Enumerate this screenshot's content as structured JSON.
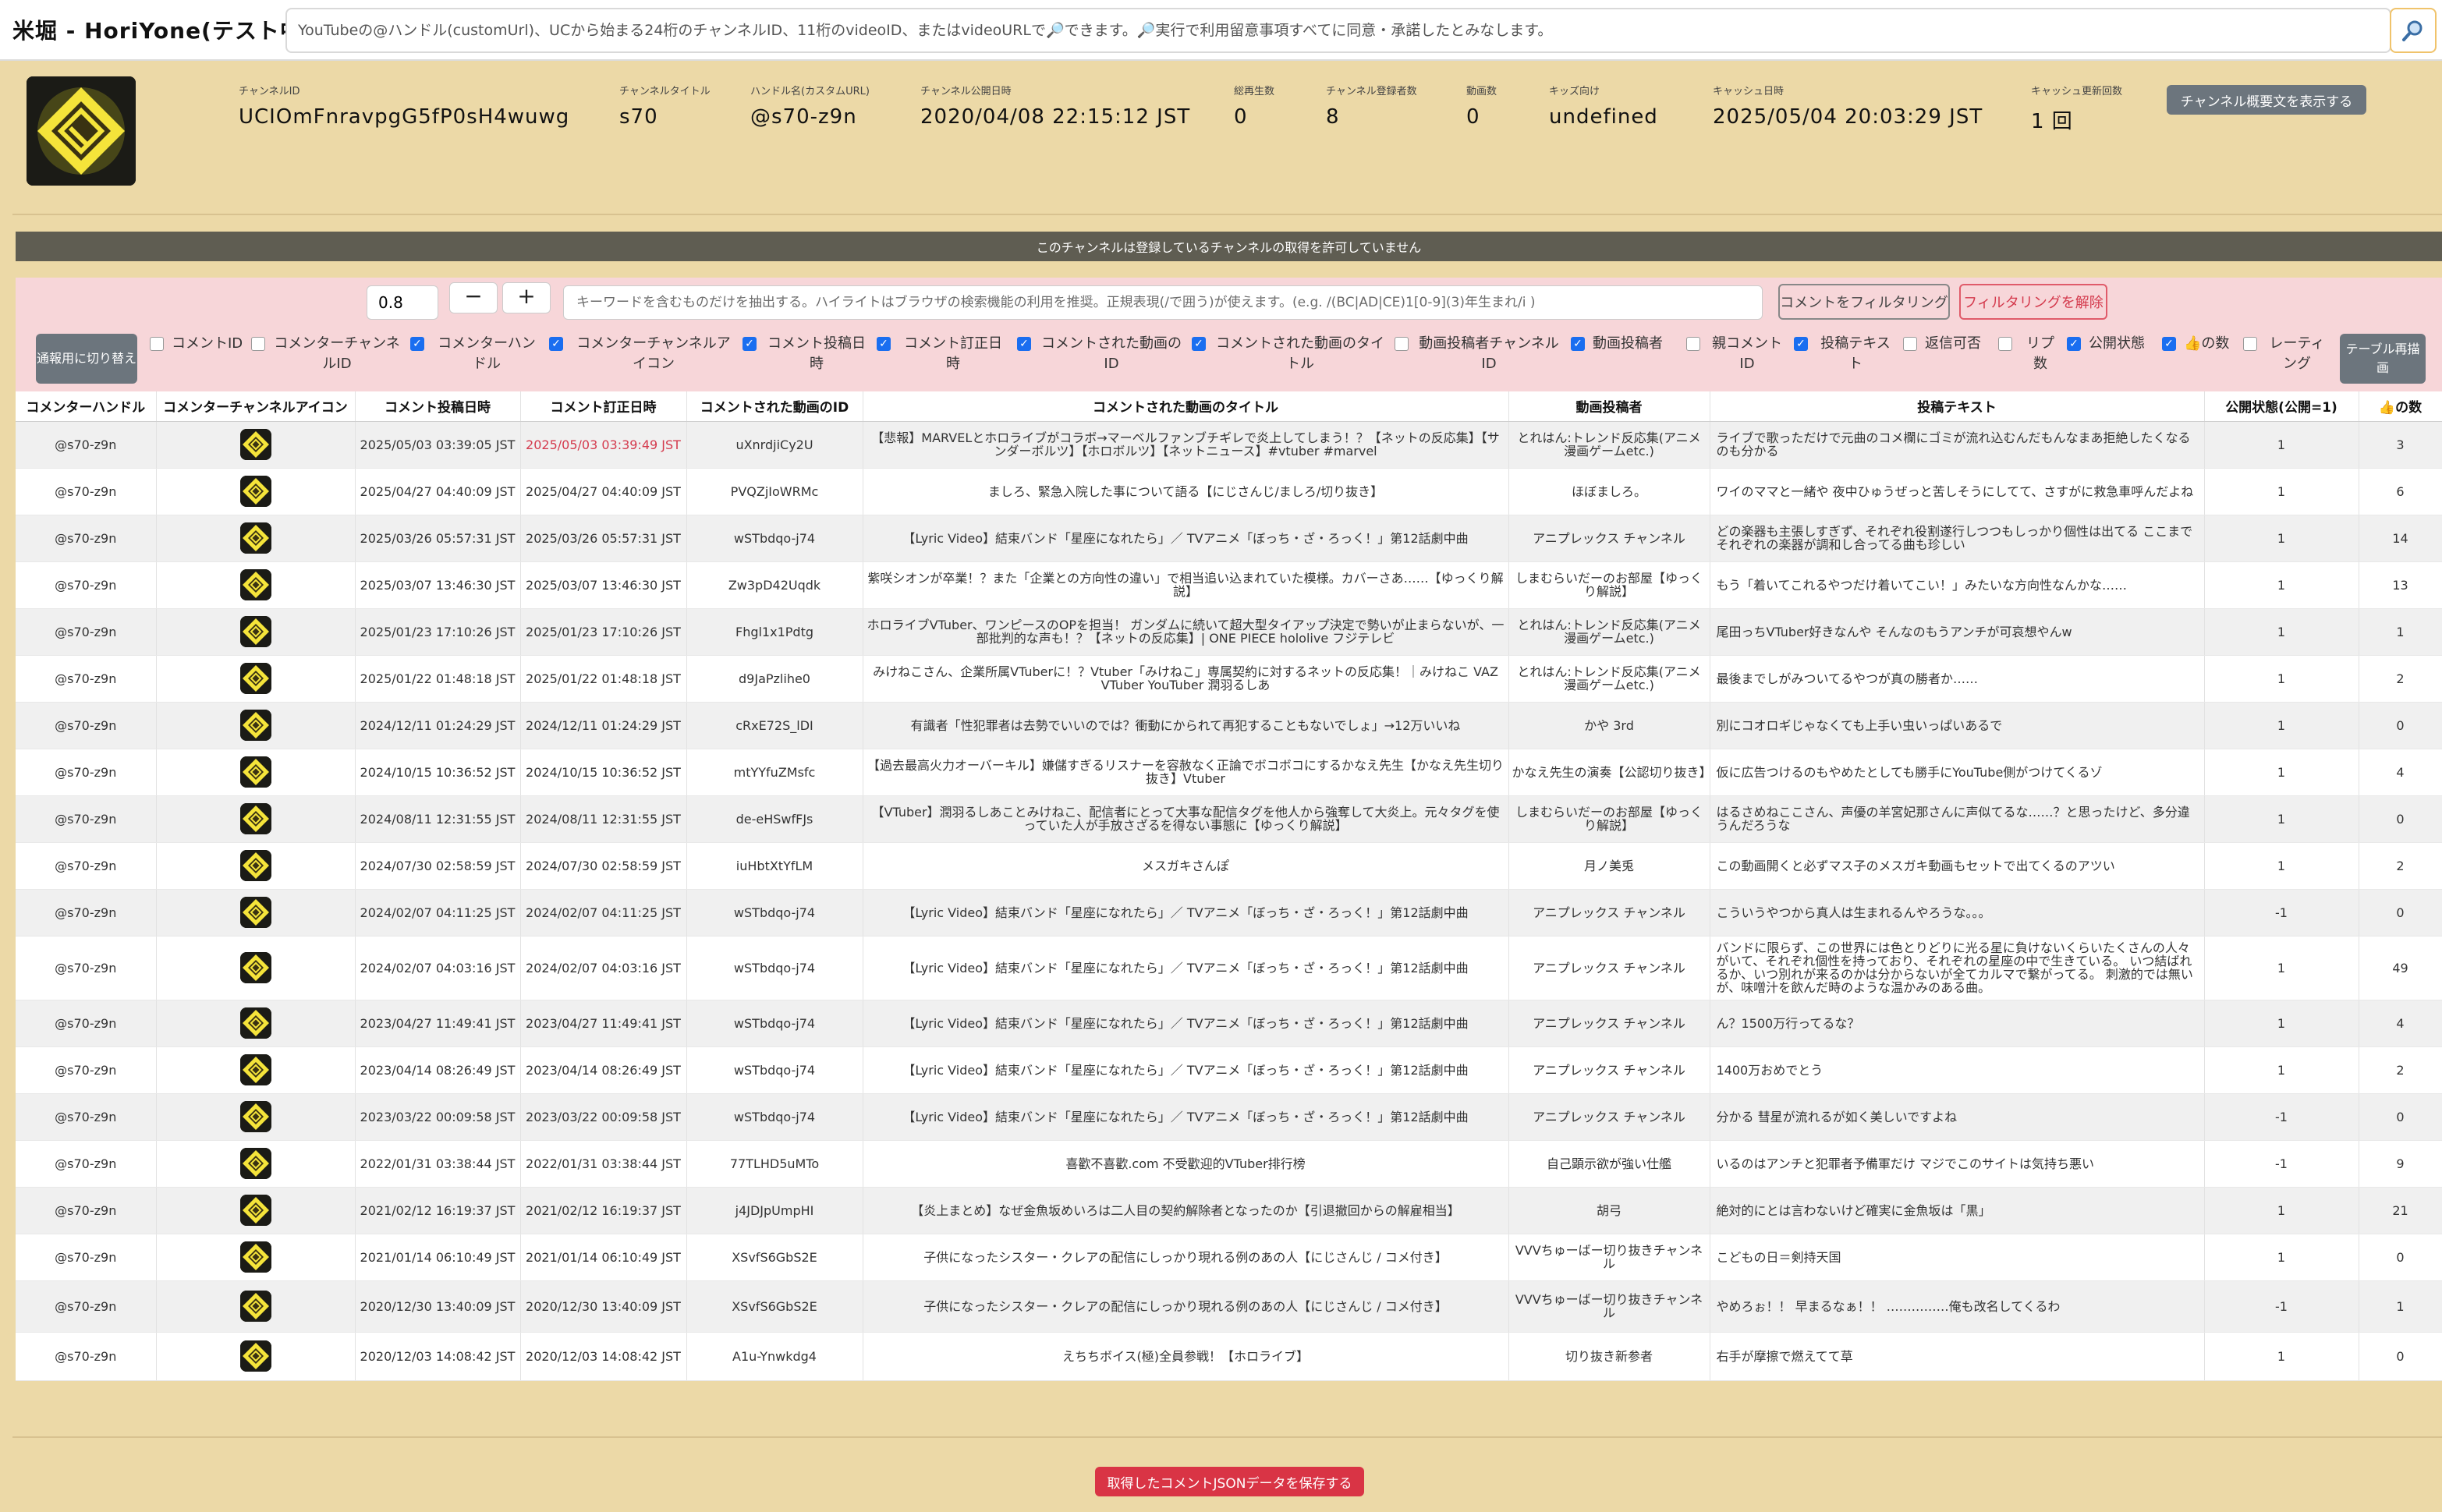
{
  "header": {
    "title": "米堀 - HoriYone(テスト中)",
    "search_placeholder": "YouTubeの@ハンドル(customUrl)、UCから始まる24桁のチャンネルID、11桁のvideoID、またはvideoURLで🔎できます。🔎実行で利用留意事項すべてに同意・承諾したとみなします。",
    "search_icon": "search-icon"
  },
  "channel": {
    "avatar_icon": "channel-avatar-icon",
    "fields": [
      {
        "label": "チャンネルID",
        "value": "UCIOmFnravpgG5fP0sH4wuwg"
      },
      {
        "label": "チャンネルタイトル",
        "value": "s70"
      },
      {
        "label": "ハンドル名(カスタムURL)",
        "value": "@s70-z9n"
      },
      {
        "label": "チャンネル公開日時",
        "value": "2020/04/08 22:15:12 JST"
      },
      {
        "label": "総再生数",
        "value": "0"
      },
      {
        "label": "チャンネル登録者数",
        "value": "8"
      },
      {
        "label": "動画数",
        "value": "0"
      },
      {
        "label": "キッズ向け",
        "value": "undefined"
      },
      {
        "label": "キャッシュ日時",
        "value": "2025/05/04 20:03:29 JST"
      },
      {
        "label": "キャッシュ更新回数",
        "value": "1 回"
      }
    ],
    "show_description_label": "チャンネル概要文を表示する"
  },
  "notice": "このチャンネルは登録しているチャンネルの取得を許可していません",
  "filter": {
    "zoom_value": "0.8",
    "zoom_minus_label": "−",
    "zoom_plus_label": "+",
    "keyword_placeholder": "キーワードを含むものだけを抽出する。ハイライトはブラウザの検索機能の利用を推奨。正規表現(/で囲う)が使えます。(e.g. /(BC|AD|CE)1[0-9](3)年生まれ/i )",
    "apply_label": "コメントをフィルタリング",
    "clear_label": "フィルタリングを解除",
    "mode_toggle_label": "通報用に切り替え",
    "rerender_label": "テーブル再描画",
    "columns": [
      {
        "label": "コメントID",
        "checked": false
      },
      {
        "label": "コメンターチャンネルID",
        "checked": false
      },
      {
        "label": "コメンターハンドル",
        "checked": true
      },
      {
        "label": "コメンターチャンネルアイコン",
        "checked": true
      },
      {
        "label": "コメント投稿日時",
        "checked": true
      },
      {
        "label": "コメント訂正日時",
        "checked": true
      },
      {
        "label": "コメントされた動画のID",
        "checked": true
      },
      {
        "label": "コメントされた動画のタイトル",
        "checked": true
      },
      {
        "label": "動画投稿者チャンネルID",
        "checked": false
      },
      {
        "label": "動画投稿者",
        "checked": true
      },
      {
        "label": "親コメントID",
        "checked": false
      },
      {
        "label": "投稿テキスト",
        "checked": true
      },
      {
        "label": "返信可否",
        "checked": false
      },
      {
        "label": "リプ数",
        "checked": false
      },
      {
        "label": "公開状態",
        "checked": true
      },
      {
        "label": "👍の数",
        "checked": true
      },
      {
        "label": "レーティング",
        "checked": false
      }
    ]
  },
  "table": {
    "headers": [
      "コメンターハンドル",
      "コメンターチャンネルアイコン",
      "コメント投稿日時",
      "コメント訂正日時",
      "コメントされた動画のID",
      "コメントされた動画のタイトル",
      "動画投稿者",
      "投稿テキスト",
      "公開状態(公開=1)",
      "👍の数"
    ],
    "rows": [
      {
        "handle": "@s70-z9n",
        "posted": "2025/05/03 03:39:05 JST",
        "edited": "2025/05/03 03:39:49 JST",
        "edited_flag": true,
        "video_id": "uXnrdjiCy2U",
        "video_title": "【悲報】MARVELとホロライブがコラボ→マーベルファンブチギレで炎上してしまう！？【ネットの反応集】【サンダーボルツ】【ホロボルツ】【ネットニュース】#vtuber #marvel",
        "uploader": "とれはん:トレンド反応集(アニメ漫画ゲームetc.)",
        "text": "ライブで歌っただけで元曲のコメ欄にゴミが流れ込むんだもんなまあ拒絶したくなるのも分かる",
        "status": "1",
        "likes": "3"
      },
      {
        "handle": "@s70-z9n",
        "posted": "2025/04/27 04:40:09 JST",
        "edited": "2025/04/27 04:40:09 JST",
        "edited_flag": false,
        "video_id": "PVQZjIoWRMc",
        "video_title": "ましろ、緊急入院した事について語る【にじさんじ/ましろ/切り抜き】",
        "uploader": "ほぼましろ。",
        "text": "ワイのママと一緒や 夜中ひゅうぜっと苦しそうにしてて、さすがに救急車呼んだよね",
        "status": "1",
        "likes": "6"
      },
      {
        "handle": "@s70-z9n",
        "posted": "2025/03/26 05:57:31 JST",
        "edited": "2025/03/26 05:57:31 JST",
        "edited_flag": false,
        "video_id": "wSTbdqo-j74",
        "video_title": "【Lyric Video】結束バンド「星座になれたら」／ TVアニメ「ぼっち・ざ・ろっく！」第12話劇中曲",
        "uploader": "アニプレックス チャンネル",
        "text": "どの楽器も主張しすぎず、それぞれ役割遂行しつつもしっかり個性は出てる ここまでそれぞれの楽器が調和し合ってる曲も珍しい",
        "status": "1",
        "likes": "14"
      },
      {
        "handle": "@s70-z9n",
        "posted": "2025/03/07 13:46:30 JST",
        "edited": "2025/03/07 13:46:30 JST",
        "edited_flag": false,
        "video_id": "Zw3pD42Uqdk",
        "video_title": "紫咲シオンが卒業！？また「企業との方向性の違い」で相当追い込まれていた模様。カバーさあ……【ゆっくり解説】",
        "uploader": "しまむらいだーのお部屋【ゆっくり解説】",
        "text": "もう「着いてこれるやつだけ着いてこい！」みたいな方向性なんかな……",
        "status": "1",
        "likes": "13"
      },
      {
        "handle": "@s70-z9n",
        "posted": "2025/01/23 17:10:26 JST",
        "edited": "2025/01/23 17:10:26 JST",
        "edited_flag": false,
        "video_id": "Fhgl1x1Pdtg",
        "video_title": "ホロライブVTuber、ワンピースのOPを担当！ ガンダムに続いて超大型タイアップ決定で勢いが止まらないが、一部批判的な声も！？【ネットの反応集】| ONE PIECE hololive フジテレビ",
        "uploader": "とれはん:トレンド反応集(アニメ漫画ゲームetc.)",
        "text": "尾田っちVTuber好きなんや そんなのもうアンチが可哀想やんw",
        "status": "1",
        "likes": "1"
      },
      {
        "handle": "@s70-z9n",
        "posted": "2025/01/22 01:48:18 JST",
        "edited": "2025/01/22 01:48:18 JST",
        "edited_flag": false,
        "video_id": "d9JaPzlihe0",
        "video_title": "みけねこさん、企業所属VTuberに！？Vtuber「みけねこ」専属契約に対するネットの反応集！｜みけねこ VAZ VTuber YouTuber 潤羽るしあ",
        "uploader": "とれはん:トレンド反応集(アニメ漫画ゲームetc.)",
        "text": "最後までしがみついてるやつが真の勝者か……",
        "status": "1",
        "likes": "2"
      },
      {
        "handle": "@s70-z9n",
        "posted": "2024/12/11 01:24:29 JST",
        "edited": "2024/12/11 01:24:29 JST",
        "edited_flag": false,
        "video_id": "cRxE72S_lDI",
        "video_title": "有識者「性犯罪者は去勢でいいのでは？衝動にかられて再犯することもないでしょ」→12万いいね",
        "uploader": "かや 3rd",
        "text": "別にコオロギじゃなくても上手い虫いっぱいあるで",
        "status": "1",
        "likes": "0"
      },
      {
        "handle": "@s70-z9n",
        "posted": "2024/10/15 10:36:52 JST",
        "edited": "2024/10/15 10:36:52 JST",
        "edited_flag": false,
        "video_id": "mtYYfuZMsfc",
        "video_title": "【過去最高火力オーバーキル】嫌儲すぎるリスナーを容赦なく正論でボコボコにするかなえ先生【かなえ先生切り抜き】Vtuber",
        "uploader": "かなえ先生の演奏【公認切り抜き】",
        "text": "仮に広告つけるのもやめたとしても勝手にYouTube側がつけてくるゾ",
        "status": "1",
        "likes": "4"
      },
      {
        "handle": "@s70-z9n",
        "posted": "2024/08/11 12:31:55 JST",
        "edited": "2024/08/11 12:31:55 JST",
        "edited_flag": false,
        "video_id": "de-eHSwfFJs",
        "video_title": "【VTuber】潤羽るしあことみけねこ、配信者にとって大事な配信タグを他人から強奪して大炎上。元々タグを使っていた人が手放さざるを得ない事態に【ゆっくり解説】",
        "uploader": "しまむらいだーのお部屋【ゆっくり解説】",
        "text": "はるさめねここさん、声優の羊宮妃那さんに声似てるな……？と思ったけど、多分違うんだろうな",
        "status": "1",
        "likes": "0"
      },
      {
        "handle": "@s70-z9n",
        "posted": "2024/07/30 02:58:59 JST",
        "edited": "2024/07/30 02:58:59 JST",
        "edited_flag": false,
        "video_id": "iuHbtXtYfLM",
        "video_title": "メスガキさんぽ",
        "uploader": "月ノ美兎",
        "text": "この動画開くと必ずマス子のメスガキ動画もセットで出てくるのアツい",
        "status": "1",
        "likes": "2"
      },
      {
        "handle": "@s70-z9n",
        "posted": "2024/02/07 04:11:25 JST",
        "edited": "2024/02/07 04:11:25 JST",
        "edited_flag": false,
        "video_id": "wSTbdqo-j74",
        "video_title": "【Lyric Video】結束バンド「星座になれたら」／ TVアニメ「ぼっち・ざ・ろっく！」第12話劇中曲",
        "uploader": "アニプレックス チャンネル",
        "text": "こういうやつから真人は生まれるんやろうな。。。",
        "status": "-1",
        "likes": "0"
      },
      {
        "handle": "@s70-z9n",
        "posted": "2024/02/07 04:03:16 JST",
        "edited": "2024/02/07 04:03:16 JST",
        "edited_flag": false,
        "video_id": "wSTbdqo-j74",
        "video_title": "【Lyric Video】結束バンド「星座になれたら」／ TVアニメ「ぼっち・ざ・ろっく！」第12話劇中曲",
        "uploader": "アニプレックス チャンネル",
        "text": "バンドに限らず、この世界には色とりどりに光る星に負けないくらいたくさんの人々がいて、それぞれ個性を持っており、それぞれの星座の中で生きている。 いつ結ばれるか、いつ別れが来るのかは分からないが全てカルマで繋がってる。 刺激的では無いが、味噌汁を飲んだ時のような温かみのある曲。",
        "status": "1",
        "likes": "49"
      },
      {
        "handle": "@s70-z9n",
        "posted": "2023/04/27 11:49:41 JST",
        "edited": "2023/04/27 11:49:41 JST",
        "edited_flag": false,
        "video_id": "wSTbdqo-j74",
        "video_title": "【Lyric Video】結束バンド「星座になれたら」／ TVアニメ「ぼっち・ざ・ろっく！」第12話劇中曲",
        "uploader": "アニプレックス チャンネル",
        "text": "ん？1500万行ってるな？",
        "status": "1",
        "likes": "4"
      },
      {
        "handle": "@s70-z9n",
        "posted": "2023/04/14 08:26:49 JST",
        "edited": "2023/04/14 08:26:49 JST",
        "edited_flag": false,
        "video_id": "wSTbdqo-j74",
        "video_title": "【Lyric Video】結束バンド「星座になれたら」／ TVアニメ「ぼっち・ざ・ろっく！」第12話劇中曲",
        "uploader": "アニプレックス チャンネル",
        "text": "1400万おめでとう",
        "status": "1",
        "likes": "2"
      },
      {
        "handle": "@s70-z9n",
        "posted": "2023/03/22 00:09:58 JST",
        "edited": "2023/03/22 00:09:58 JST",
        "edited_flag": false,
        "video_id": "wSTbdqo-j74",
        "video_title": "【Lyric Video】結束バンド「星座になれたら」／ TVアニメ「ぼっち・ざ・ろっく！」第12話劇中曲",
        "uploader": "アニプレックス チャンネル",
        "text": "分かる 彗星が流れるが如く美しいですよね",
        "status": "-1",
        "likes": "0"
      },
      {
        "handle": "@s70-z9n",
        "posted": "2022/01/31 03:38:44 JST",
        "edited": "2022/01/31 03:38:44 JST",
        "edited_flag": false,
        "video_id": "77TLHD5uMTo",
        "video_title": "喜歡不喜歡.com 不受歡迎的VTuber排行榜",
        "uploader": "自己顕示欲が強い仕艦",
        "text": "いるのはアンチと犯罪者予備軍だけ マジでこのサイトは気持ち悪い",
        "status": "-1",
        "likes": "9"
      },
      {
        "handle": "@s70-z9n",
        "posted": "2021/02/12 16:19:37 JST",
        "edited": "2021/02/12 16:19:37 JST",
        "edited_flag": false,
        "video_id": "j4JDJpUmpHI",
        "video_title": "【炎上まとめ】なぜ金魚坂めいろは二人目の契約解除者となったのか【引退撤回からの解雇相当】",
        "uploader": "胡弓",
        "text": "絶対的にとは言わないけど確実に金魚坂は「黒」",
        "status": "1",
        "likes": "21"
      },
      {
        "handle": "@s70-z9n",
        "posted": "2021/01/14 06:10:49 JST",
        "edited": "2021/01/14 06:10:49 JST",
        "edited_flag": false,
        "video_id": "XSvfS6GbS2E",
        "video_title": "子供になったシスター・クレアの配信にしっかり現れる例のあの人【にじさんじ / コメ付き】",
        "uploader": "VVVちゅーばー切り抜きチャンネル",
        "text": "こどもの日＝剣持天国",
        "status": "1",
        "likes": "0"
      },
      {
        "handle": "@s70-z9n",
        "posted": "2020/12/30 13:40:09 JST",
        "edited": "2020/12/30 13:40:09 JST",
        "edited_flag": false,
        "video_id": "XSvfS6GbS2E",
        "video_title": "子供になったシスター・クレアの配信にしっかり現れる例のあの人【にじさんじ / コメ付き】",
        "uploader": "VVVちゅーばー切り抜きチャンネル",
        "text": "やめろぉ！！ 早まるなぁ！！ ……………俺も改名してくるわ",
        "status": "-1",
        "likes": "1"
      },
      {
        "handle": "@s70-z9n",
        "posted": "2020/12/03 14:08:42 JST",
        "edited": "2020/12/03 14:08:42 JST",
        "edited_flag": false,
        "video_id": "A1u-Ynwkdg4",
        "video_title": "えちちボイス(極)全員参戦！【ホロライブ】",
        "uploader": "切り抜き新参者",
        "text": "右手が摩擦で燃えてて草",
        "status": "1",
        "likes": "0"
      }
    ]
  },
  "footer": {
    "save_label": "取得したコメントJSONデータを保存する"
  },
  "colors": {
    "page_bg": "#ecd9a7",
    "notice_bg": "#5f5d52",
    "filter_bg": "#f7d6d9",
    "danger": "#d93445",
    "secondary": "#6c757d",
    "checkbox_on": "#1a6ef0",
    "avatar_gold": "#f5e43a"
  }
}
